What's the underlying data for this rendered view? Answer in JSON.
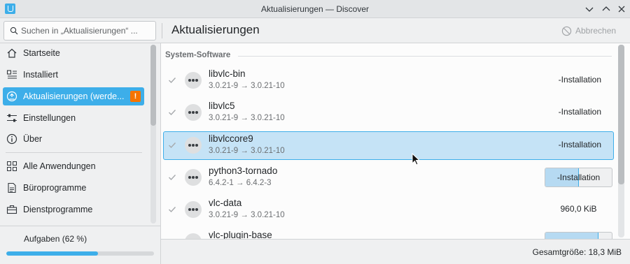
{
  "window": {
    "title": "Aktualisierungen — Discover"
  },
  "header": {
    "search_placeholder": "Suchen in „Aktualisierungen“ ...",
    "page_title": "Aktualisierungen",
    "cancel_label": "Abbrechen"
  },
  "sidebar": {
    "items": [
      {
        "label": "Startseite",
        "icon": "home-icon"
      },
      {
        "label": "Installiert",
        "icon": "installed-list-icon"
      },
      {
        "label": "Aktualisierungen (werde...",
        "icon": "updates-icon",
        "badge": "!"
      },
      {
        "label": "Einstellungen",
        "icon": "settings-sliders-icon"
      },
      {
        "label": "Über",
        "icon": "info-icon"
      },
      {
        "label": "Alle Anwendungen",
        "icon": "grid-icon"
      },
      {
        "label": "Büroprogramme",
        "icon": "office-icon"
      },
      {
        "label": "Dienstprogramme",
        "icon": "toolbox-icon"
      }
    ],
    "tasks_label": "Aufgaben (62 %)",
    "tasks_progress": 0.62
  },
  "main": {
    "section_title": "System-Software",
    "packages": [
      {
        "name": "libvlc-bin",
        "version": "3.0.21-9 → 3.0.21-10",
        "status": "-Installation"
      },
      {
        "name": "libvlc5",
        "version": "3.0.21-9 → 3.0.21-10",
        "status": "-Installation"
      },
      {
        "name": "libvlccore9",
        "version": "3.0.21-9 → 3.0.21-10",
        "status": "-Installation"
      },
      {
        "name": "python3-tornado",
        "version": "6.4.2-1 → 6.4.2-3",
        "status": "-Installation",
        "progress": 0.5
      },
      {
        "name": "vlc-data",
        "version": "3.0.21-9 → 3.0.21-10",
        "status": "960,0 KiB"
      },
      {
        "name": "vlc-plugin-base",
        "version": "",
        "status": "",
        "progress": 0.8
      }
    ]
  },
  "footer": {
    "total_size": "Gesamtgröße: 18,3 MiB"
  },
  "colors": {
    "accent": "#3daee9",
    "badge": "#f67400",
    "selection": "#c5e3f6"
  }
}
